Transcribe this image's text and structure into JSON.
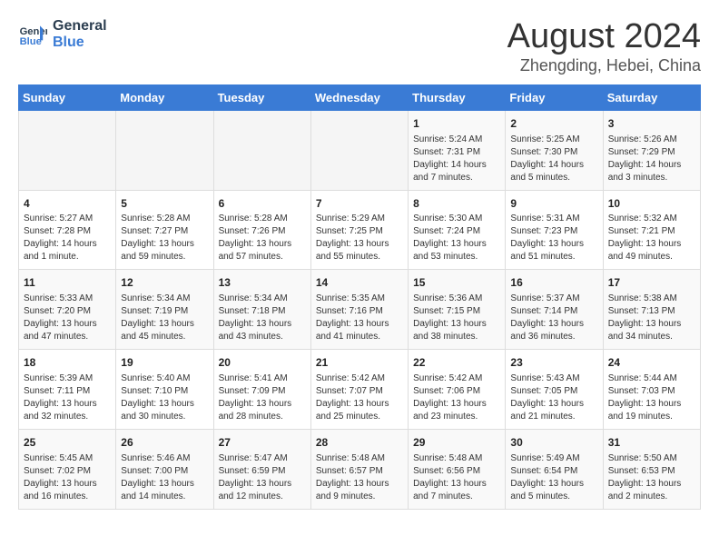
{
  "header": {
    "logo_line1": "General",
    "logo_line2": "Blue",
    "month": "August 2024",
    "location": "Zhengding, Hebei, China"
  },
  "weekdays": [
    "Sunday",
    "Monday",
    "Tuesday",
    "Wednesday",
    "Thursday",
    "Friday",
    "Saturday"
  ],
  "weeks": [
    [
      {
        "day": "",
        "detail": ""
      },
      {
        "day": "",
        "detail": ""
      },
      {
        "day": "",
        "detail": ""
      },
      {
        "day": "",
        "detail": ""
      },
      {
        "day": "1",
        "detail": "Sunrise: 5:24 AM\nSunset: 7:31 PM\nDaylight: 14 hours\nand 7 minutes."
      },
      {
        "day": "2",
        "detail": "Sunrise: 5:25 AM\nSunset: 7:30 PM\nDaylight: 14 hours\nand 5 minutes."
      },
      {
        "day": "3",
        "detail": "Sunrise: 5:26 AM\nSunset: 7:29 PM\nDaylight: 14 hours\nand 3 minutes."
      }
    ],
    [
      {
        "day": "4",
        "detail": "Sunrise: 5:27 AM\nSunset: 7:28 PM\nDaylight: 14 hours\nand 1 minute."
      },
      {
        "day": "5",
        "detail": "Sunrise: 5:28 AM\nSunset: 7:27 PM\nDaylight: 13 hours\nand 59 minutes."
      },
      {
        "day": "6",
        "detail": "Sunrise: 5:28 AM\nSunset: 7:26 PM\nDaylight: 13 hours\nand 57 minutes."
      },
      {
        "day": "7",
        "detail": "Sunrise: 5:29 AM\nSunset: 7:25 PM\nDaylight: 13 hours\nand 55 minutes."
      },
      {
        "day": "8",
        "detail": "Sunrise: 5:30 AM\nSunset: 7:24 PM\nDaylight: 13 hours\nand 53 minutes."
      },
      {
        "day": "9",
        "detail": "Sunrise: 5:31 AM\nSunset: 7:23 PM\nDaylight: 13 hours\nand 51 minutes."
      },
      {
        "day": "10",
        "detail": "Sunrise: 5:32 AM\nSunset: 7:21 PM\nDaylight: 13 hours\nand 49 minutes."
      }
    ],
    [
      {
        "day": "11",
        "detail": "Sunrise: 5:33 AM\nSunset: 7:20 PM\nDaylight: 13 hours\nand 47 minutes."
      },
      {
        "day": "12",
        "detail": "Sunrise: 5:34 AM\nSunset: 7:19 PM\nDaylight: 13 hours\nand 45 minutes."
      },
      {
        "day": "13",
        "detail": "Sunrise: 5:34 AM\nSunset: 7:18 PM\nDaylight: 13 hours\nand 43 minutes."
      },
      {
        "day": "14",
        "detail": "Sunrise: 5:35 AM\nSunset: 7:16 PM\nDaylight: 13 hours\nand 41 minutes."
      },
      {
        "day": "15",
        "detail": "Sunrise: 5:36 AM\nSunset: 7:15 PM\nDaylight: 13 hours\nand 38 minutes."
      },
      {
        "day": "16",
        "detail": "Sunrise: 5:37 AM\nSunset: 7:14 PM\nDaylight: 13 hours\nand 36 minutes."
      },
      {
        "day": "17",
        "detail": "Sunrise: 5:38 AM\nSunset: 7:13 PM\nDaylight: 13 hours\nand 34 minutes."
      }
    ],
    [
      {
        "day": "18",
        "detail": "Sunrise: 5:39 AM\nSunset: 7:11 PM\nDaylight: 13 hours\nand 32 minutes."
      },
      {
        "day": "19",
        "detail": "Sunrise: 5:40 AM\nSunset: 7:10 PM\nDaylight: 13 hours\nand 30 minutes."
      },
      {
        "day": "20",
        "detail": "Sunrise: 5:41 AM\nSunset: 7:09 PM\nDaylight: 13 hours\nand 28 minutes."
      },
      {
        "day": "21",
        "detail": "Sunrise: 5:42 AM\nSunset: 7:07 PM\nDaylight: 13 hours\nand 25 minutes."
      },
      {
        "day": "22",
        "detail": "Sunrise: 5:42 AM\nSunset: 7:06 PM\nDaylight: 13 hours\nand 23 minutes."
      },
      {
        "day": "23",
        "detail": "Sunrise: 5:43 AM\nSunset: 7:05 PM\nDaylight: 13 hours\nand 21 minutes."
      },
      {
        "day": "24",
        "detail": "Sunrise: 5:44 AM\nSunset: 7:03 PM\nDaylight: 13 hours\nand 19 minutes."
      }
    ],
    [
      {
        "day": "25",
        "detail": "Sunrise: 5:45 AM\nSunset: 7:02 PM\nDaylight: 13 hours\nand 16 minutes."
      },
      {
        "day": "26",
        "detail": "Sunrise: 5:46 AM\nSunset: 7:00 PM\nDaylight: 13 hours\nand 14 minutes."
      },
      {
        "day": "27",
        "detail": "Sunrise: 5:47 AM\nSunset: 6:59 PM\nDaylight: 13 hours\nand 12 minutes."
      },
      {
        "day": "28",
        "detail": "Sunrise: 5:48 AM\nSunset: 6:57 PM\nDaylight: 13 hours\nand 9 minutes."
      },
      {
        "day": "29",
        "detail": "Sunrise: 5:48 AM\nSunset: 6:56 PM\nDaylight: 13 hours\nand 7 minutes."
      },
      {
        "day": "30",
        "detail": "Sunrise: 5:49 AM\nSunset: 6:54 PM\nDaylight: 13 hours\nand 5 minutes."
      },
      {
        "day": "31",
        "detail": "Sunrise: 5:50 AM\nSunset: 6:53 PM\nDaylight: 13 hours\nand 2 minutes."
      }
    ]
  ]
}
